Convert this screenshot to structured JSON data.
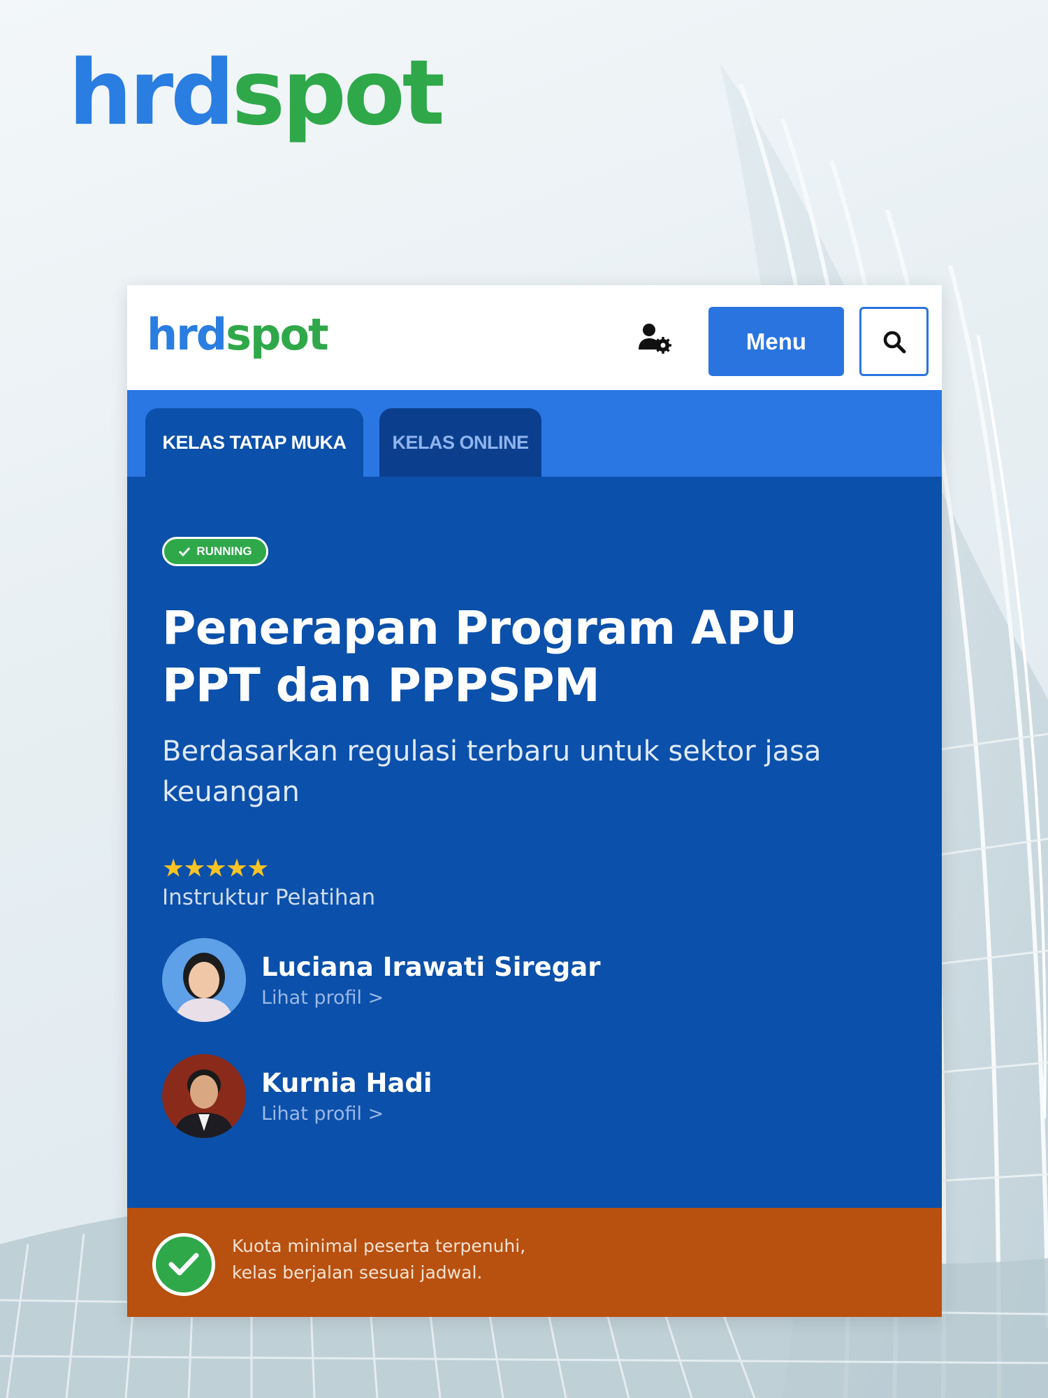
{
  "brand": {
    "part1": "hrd",
    "part2": "spot",
    "color_primary": "#2a7de1",
    "color_secondary": "#2fa84a"
  },
  "header": {
    "user_icon": "user-gear-icon",
    "menu_label": "Menu",
    "search_icon": "search-icon"
  },
  "tabs": [
    {
      "label": "KELAS TATAP MUKA",
      "active": true
    },
    {
      "label": "KELAS ONLINE",
      "active": false
    }
  ],
  "course": {
    "status_badge": "RUNNING",
    "title": "Penerapan Program APU PPT dan PPPSPM",
    "subtitle": "Berdasarkan regulasi terbaru untuk sektor jasa keuangan",
    "rating": {
      "stars": 5,
      "max": 5,
      "display": "★★★★★"
    },
    "instructor_label": "Instruktur Pelatihan",
    "instructors": [
      {
        "name": "Luciana Irawati Siregar",
        "link": "Lihat profil >"
      },
      {
        "name": "Kurnia Hadi",
        "link": "Lihat profil >"
      }
    ]
  },
  "footer": {
    "icon": "check-circle-icon",
    "line1": "Kuota minimal peserta terpenuhi,",
    "line2": "kelas berjalan sesuai jadwal."
  },
  "colors": {
    "card_blue": "#0b50aa",
    "tab_bar_blue": "#2a77e3",
    "footer_orange": "#b8500f",
    "star_gold": "#f7c325"
  }
}
